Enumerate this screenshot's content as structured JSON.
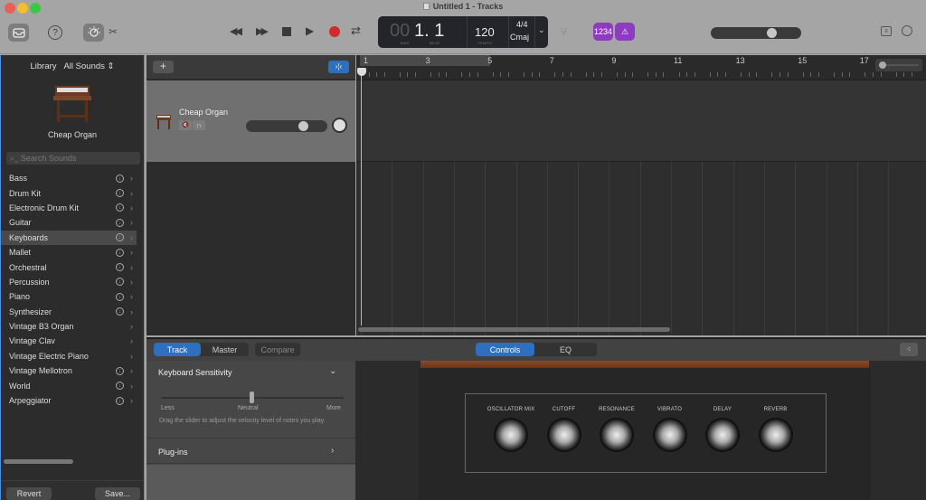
{
  "window": {
    "title": "Untitled 1 - Tracks"
  },
  "toolbar": {
    "library_icon": "library-tray-icon",
    "help_icon": "help-icon",
    "smart_controls_icon": "smart-controls-icon",
    "editors_icon": "scissors-icon",
    "transport": [
      "rewind",
      "fast-forward",
      "stop",
      "play",
      "record",
      "cycle"
    ],
    "lcd": {
      "bar_prefix": "00",
      "position": "1. 1",
      "bar_label": "BAR",
      "beat_label": "BEAT",
      "tempo": "120",
      "tempo_label": "TEMPO",
      "signature": "4/4",
      "key": "Cmaj"
    },
    "tuner_icon": "tuning-fork-icon",
    "count_in_label": "1234",
    "metronome_icon": "metronome-icon",
    "master_volume": 0.72,
    "notepad_icon": "notepad-icon",
    "loop_browser_icon": "loop-icon"
  },
  "library": {
    "title": "Library",
    "filter": "All Sounds",
    "selected_patch": "Cheap Organ",
    "search_placeholder": "Search Sounds",
    "categories": [
      {
        "label": "Bass",
        "download": true
      },
      {
        "label": "Drum Kit",
        "download": true
      },
      {
        "label": "Electronic Drum Kit",
        "download": true
      },
      {
        "label": "Guitar",
        "download": true
      },
      {
        "label": "Keyboards",
        "download": true,
        "selected": true
      },
      {
        "label": "Mallet",
        "download": true
      },
      {
        "label": "Orchestral",
        "download": true
      },
      {
        "label": "Percussion",
        "download": true
      },
      {
        "label": "Piano",
        "download": true
      },
      {
        "label": "Synthesizer",
        "download": true
      },
      {
        "label": "Vintage B3 Organ",
        "download": false
      },
      {
        "label": "Vintage Clav",
        "download": false
      },
      {
        "label": "Vintage Electric Piano",
        "download": false
      },
      {
        "label": "Vintage Mellotron",
        "download": true
      },
      {
        "label": "World",
        "download": true
      },
      {
        "label": "Arpeggiator",
        "download": true
      }
    ],
    "revert_label": "Revert",
    "save_label": "Save..."
  },
  "tracks": {
    "add_label": "+",
    "items": [
      {
        "name": "Cheap Organ",
        "volume": 0.72
      }
    ]
  },
  "ruler": {
    "bars": [
      "1",
      "3",
      "5",
      "7",
      "9",
      "11",
      "13",
      "15",
      "17"
    ]
  },
  "smart_controls": {
    "tabs": [
      "Track",
      "Master",
      "Compare"
    ],
    "active_tab": "Track",
    "view_tabs": [
      "Controls",
      "EQ"
    ],
    "active_view": "Controls",
    "keyboard_sensitivity": {
      "title": "Keyboard Sensitivity",
      "less": "Less",
      "neutral": "Neutral",
      "more": "More",
      "value": 0.5,
      "help": "Drag the slider to adjust the velocity level of notes you play."
    },
    "plugins_label": "Plug-ins",
    "knobs": [
      "OSCILLATOR MIX",
      "CUTOFF",
      "RESONANCE",
      "VIBRATO",
      "DELAY",
      "REVERB"
    ]
  }
}
